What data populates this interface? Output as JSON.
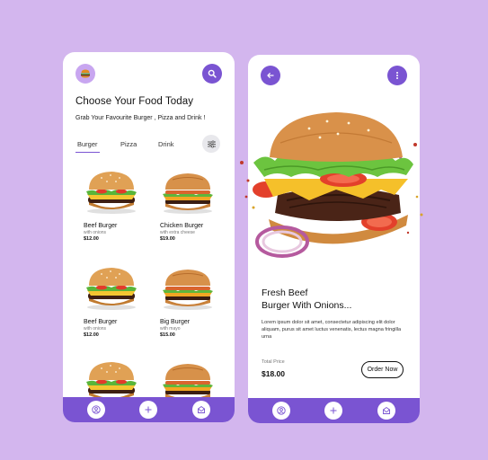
{
  "colors": {
    "background": "#d3b6ee",
    "accent": "#7a54d2",
    "accent_light": "#c8a6f0",
    "card": "#ffffff"
  },
  "list_screen": {
    "title": "Choose Your Food Today",
    "subtitle": "Grab Your Favourite Burger , Pizza and Drink !",
    "menu_icon": "burger-icon",
    "search_icon": "search-icon",
    "filter_icon": "sliders-icon",
    "tabs": [
      {
        "label": "Burger",
        "active": true
      },
      {
        "label": "Pizza",
        "active": false
      },
      {
        "label": "Drink",
        "active": false
      }
    ],
    "items": [
      {
        "name": "Beef Burger",
        "desc": "with onions",
        "price": "$12.00"
      },
      {
        "name": "Chicken Burger",
        "desc": "with extra cheese",
        "price": "$19.00"
      },
      {
        "name": "Beef Burger",
        "desc": "with onions",
        "price": "$12.00"
      },
      {
        "name": "Big Burger",
        "desc": "with mayo",
        "price": "$15.00"
      },
      {
        "name": "",
        "desc": "",
        "price": ""
      },
      {
        "name": "",
        "desc": "",
        "price": ""
      }
    ],
    "nav_icons": [
      "user-icon",
      "plus-icon",
      "mail-icon"
    ]
  },
  "detail_screen": {
    "back_icon": "arrow-left-icon",
    "more_icon": "more-vertical-icon",
    "title_line1": "Fresh Beef",
    "title_line2": "Burger With Onions...",
    "description": "Lorem ipsum dolor sit amet, consectetur adipiscing elit dolor aliquam, purus sit amet luctus venenatis, lectus magna fringilla urna",
    "total_label": "Total Price",
    "total_value": "$18.00",
    "order_label": "Order Now",
    "nav_icons": [
      "user-icon",
      "plus-icon",
      "mail-icon"
    ]
  }
}
